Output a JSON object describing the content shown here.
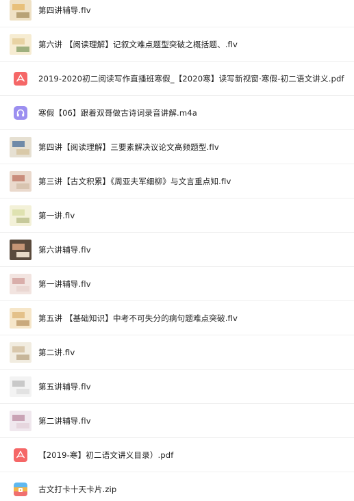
{
  "files": [
    {
      "name": "第四讲辅导.flv",
      "type": "video",
      "thumb": [
        "#efe1c5",
        "#e8c07a",
        "#b8a276"
      ]
    },
    {
      "name": "第六讲 【阅读理解】记叙文难点题型突破之概括题、.flv",
      "type": "video",
      "thumb": [
        "#f6ecd2",
        "#e8d3a4",
        "#9fb07f"
      ]
    },
    {
      "name": "2019-2020初二阅读写作直播班寒假_【2020寒】读写新视窗·寒假-初二语文讲义.pdf",
      "type": "pdf"
    },
    {
      "name": "寒假【06】跟着双哥做古诗词录音讲解.m4a",
      "type": "audio"
    },
    {
      "name": "第四讲【阅读理解】三要素解决议论文高频题型.flv",
      "type": "video",
      "thumb": [
        "#e6e0d2",
        "#6f8aa8",
        "#d9c9a8"
      ]
    },
    {
      "name": "第三讲【古文积累】《周亚夫军细柳》与文言重点知.flv",
      "type": "video",
      "thumb": [
        "#ead9cc",
        "#c98d7c",
        "#d8c4b0"
      ]
    },
    {
      "name": "第一讲.flv",
      "type": "video",
      "thumb": [
        "#f3f1d8",
        "#dfe2b0",
        "#c6c99a"
      ]
    },
    {
      "name": "第六讲辅导.flv",
      "type": "video",
      "thumb": [
        "#5a4a3c",
        "#c59576",
        "#e8d9c6"
      ]
    },
    {
      "name": "第一讲辅导.flv",
      "type": "video",
      "thumb": [
        "#f2e4e0",
        "#d9aeaa",
        "#ead7d2"
      ]
    },
    {
      "name": "第五讲 【基础知识】中考不可失分的病句题难点突破.flv",
      "type": "video",
      "thumb": [
        "#f6e6c9",
        "#e4c18a",
        "#c9a97c"
      ]
    },
    {
      "name": "第二讲.flv",
      "type": "video",
      "thumb": [
        "#f1ece0",
        "#d9c8ac",
        "#c7b69a"
      ]
    },
    {
      "name": "第五讲辅导.flv",
      "type": "video",
      "thumb": [
        "#f3f3f3",
        "#c9c9c9",
        "#e2e2e2"
      ]
    },
    {
      "name": "第二讲辅导.flv",
      "type": "video",
      "thumb": [
        "#f0e8ee",
        "#c9a3b5",
        "#e6d6de"
      ]
    },
    {
      "name": "【2019-寒】初二语文讲义目录）.pdf",
      "type": "pdf"
    },
    {
      "name": "古文打卡十天卡片.zip",
      "type": "zip"
    }
  ],
  "colors": {
    "pdf": "#f56767",
    "audio": "#9c8ff0",
    "text": "#1f1f1f",
    "divider": "#efefef"
  }
}
